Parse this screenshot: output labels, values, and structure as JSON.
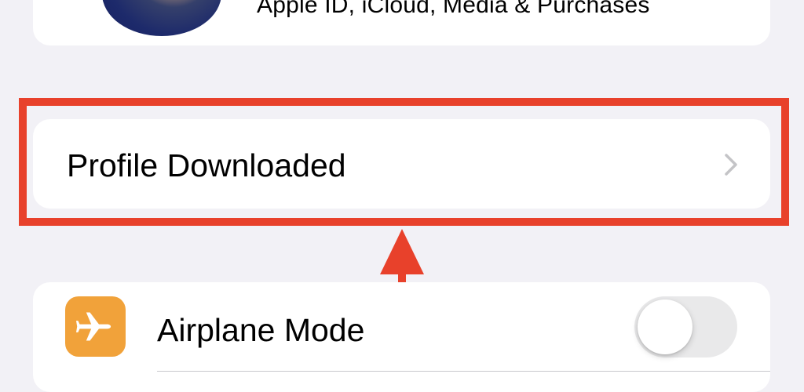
{
  "apple_id": {
    "subtitle": "Apple ID, iCloud, Media & Purchases"
  },
  "profile_row": {
    "label": "Profile Downloaded"
  },
  "airplane_row": {
    "label": "Airplane Mode",
    "toggle_on": false
  },
  "annotation": {
    "highlight_color": "#e8412b"
  },
  "colors": {
    "background": "#f2f1f6",
    "card": "#ffffff",
    "airplane_icon_bg": "#f1a23a",
    "toggle_off_track": "#e9e9ea",
    "chevron": "#c4c4c7"
  },
  "icons": {
    "chevron": "chevron-right-icon",
    "airplane": "airplane-icon",
    "avatar": "avatar"
  }
}
